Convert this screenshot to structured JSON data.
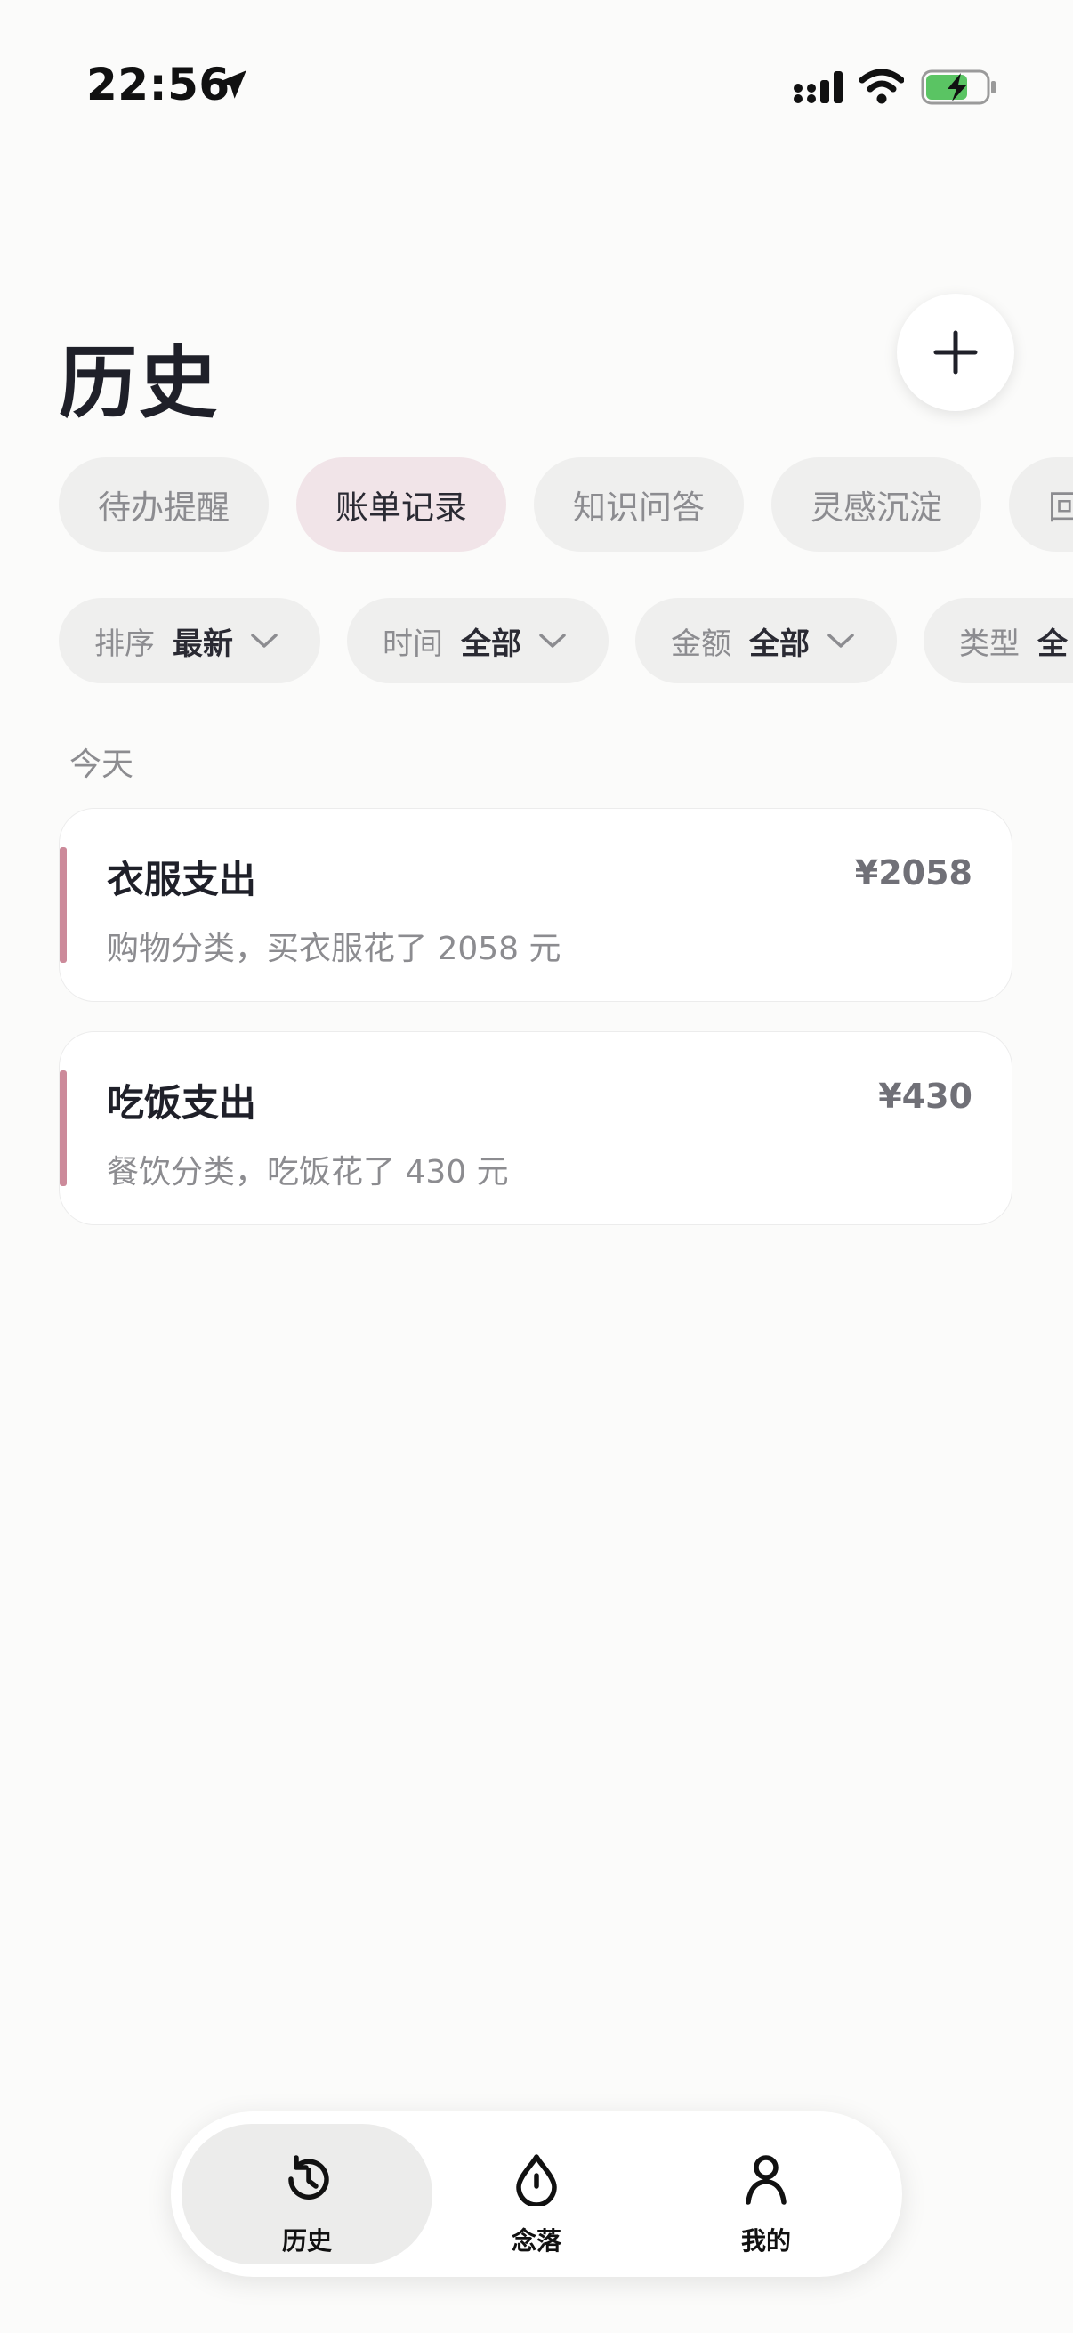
{
  "status_bar": {
    "time": "22:56"
  },
  "header": {
    "title": "历史"
  },
  "tabs": [
    {
      "label": "待办提醒",
      "active": false
    },
    {
      "label": "账单记录",
      "active": true
    },
    {
      "label": "知识问答",
      "active": false
    },
    {
      "label": "灵感沉淀",
      "active": false
    },
    {
      "label": "回",
      "active": false
    }
  ],
  "filters": [
    {
      "label": "排序",
      "value": "最新"
    },
    {
      "label": "时间",
      "value": "全部"
    },
    {
      "label": "金额",
      "value": "全部"
    },
    {
      "label": "类型",
      "value": "全"
    }
  ],
  "section": {
    "label": "今天"
  },
  "records": [
    {
      "title": "衣服支出",
      "amount": "¥2058",
      "description": "购物分类，买衣服花了 2058 元"
    },
    {
      "title": "吃饭支出",
      "amount": "¥430",
      "description": "餐饮分类，吃饭花了 430 元"
    }
  ],
  "bottom_nav": [
    {
      "label": "历史",
      "icon": "history-icon",
      "active": true
    },
    {
      "label": "念落",
      "icon": "drop-icon",
      "active": false
    },
    {
      "label": "我的",
      "icon": "user-icon",
      "active": false
    }
  ],
  "colors": {
    "accent": "#cc8a9a",
    "active_tab_bg": "#f1e4e8",
    "battery_fill": "#5ac463"
  }
}
